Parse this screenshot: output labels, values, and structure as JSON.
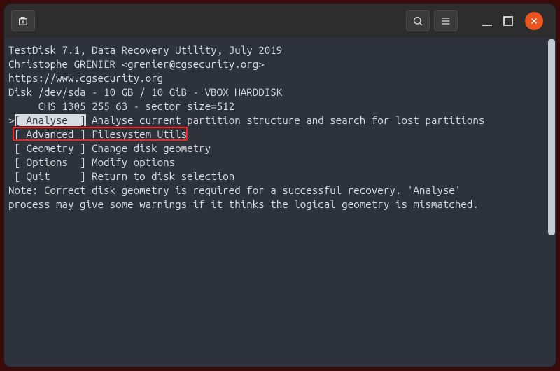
{
  "header": {
    "line1": "TestDisk 7.1, Data Recovery Utility, July 2019",
    "line2": "Christophe GRENIER <grenier@cgsecurity.org>",
    "line3": "https://www.cgsecurity.org"
  },
  "disk": {
    "line1": "Disk /dev/sda - 10 GB / 10 GiB - VBOX HARDDISK",
    "line2": "     CHS 1305 255 63 - sector size=512"
  },
  "menu": [
    {
      "prefix": ">",
      "label_bracket": "[ Analyse  ]",
      "desc": " Analyse current partition structure and search for lost partitions",
      "selected": true,
      "highlighted": false
    },
    {
      "prefix": " ",
      "label_bracket": "[ Advanced ]",
      "desc": " Filesystem Utils",
      "selected": false,
      "highlighted": true
    },
    {
      "prefix": " ",
      "label_bracket": "[ Geometry ]",
      "desc": " Change disk geometry",
      "selected": false,
      "highlighted": false
    },
    {
      "prefix": " ",
      "label_bracket": "[ Options  ]",
      "desc": " Modify options",
      "selected": false,
      "highlighted": false
    },
    {
      "prefix": " ",
      "label_bracket": "[ Quit     ]",
      "desc": " Return to disk selection",
      "selected": false,
      "highlighted": false
    }
  ],
  "note": {
    "line1": "Note: Correct disk geometry is required for a successful recovery. 'Analyse'",
    "line2": "process may give some warnings if it thinks the logical geometry is mismatched."
  },
  "icons": {
    "newtab": "newtab-icon",
    "search": "search-icon",
    "menu": "menu-icon",
    "min": "minimize-icon",
    "max": "maximize-icon",
    "close": "close-icon"
  },
  "colors": {
    "bg_outer": "#3a0a0a",
    "bg_titlebar": "#2d2d2d",
    "bg_terminal": "#2d323b",
    "fg_text": "#d8dde4",
    "selection_bg": "#d8dde4",
    "selection_fg": "#2d323b",
    "accent_close": "#e95420",
    "highlight_border": "#ff1f1f"
  }
}
